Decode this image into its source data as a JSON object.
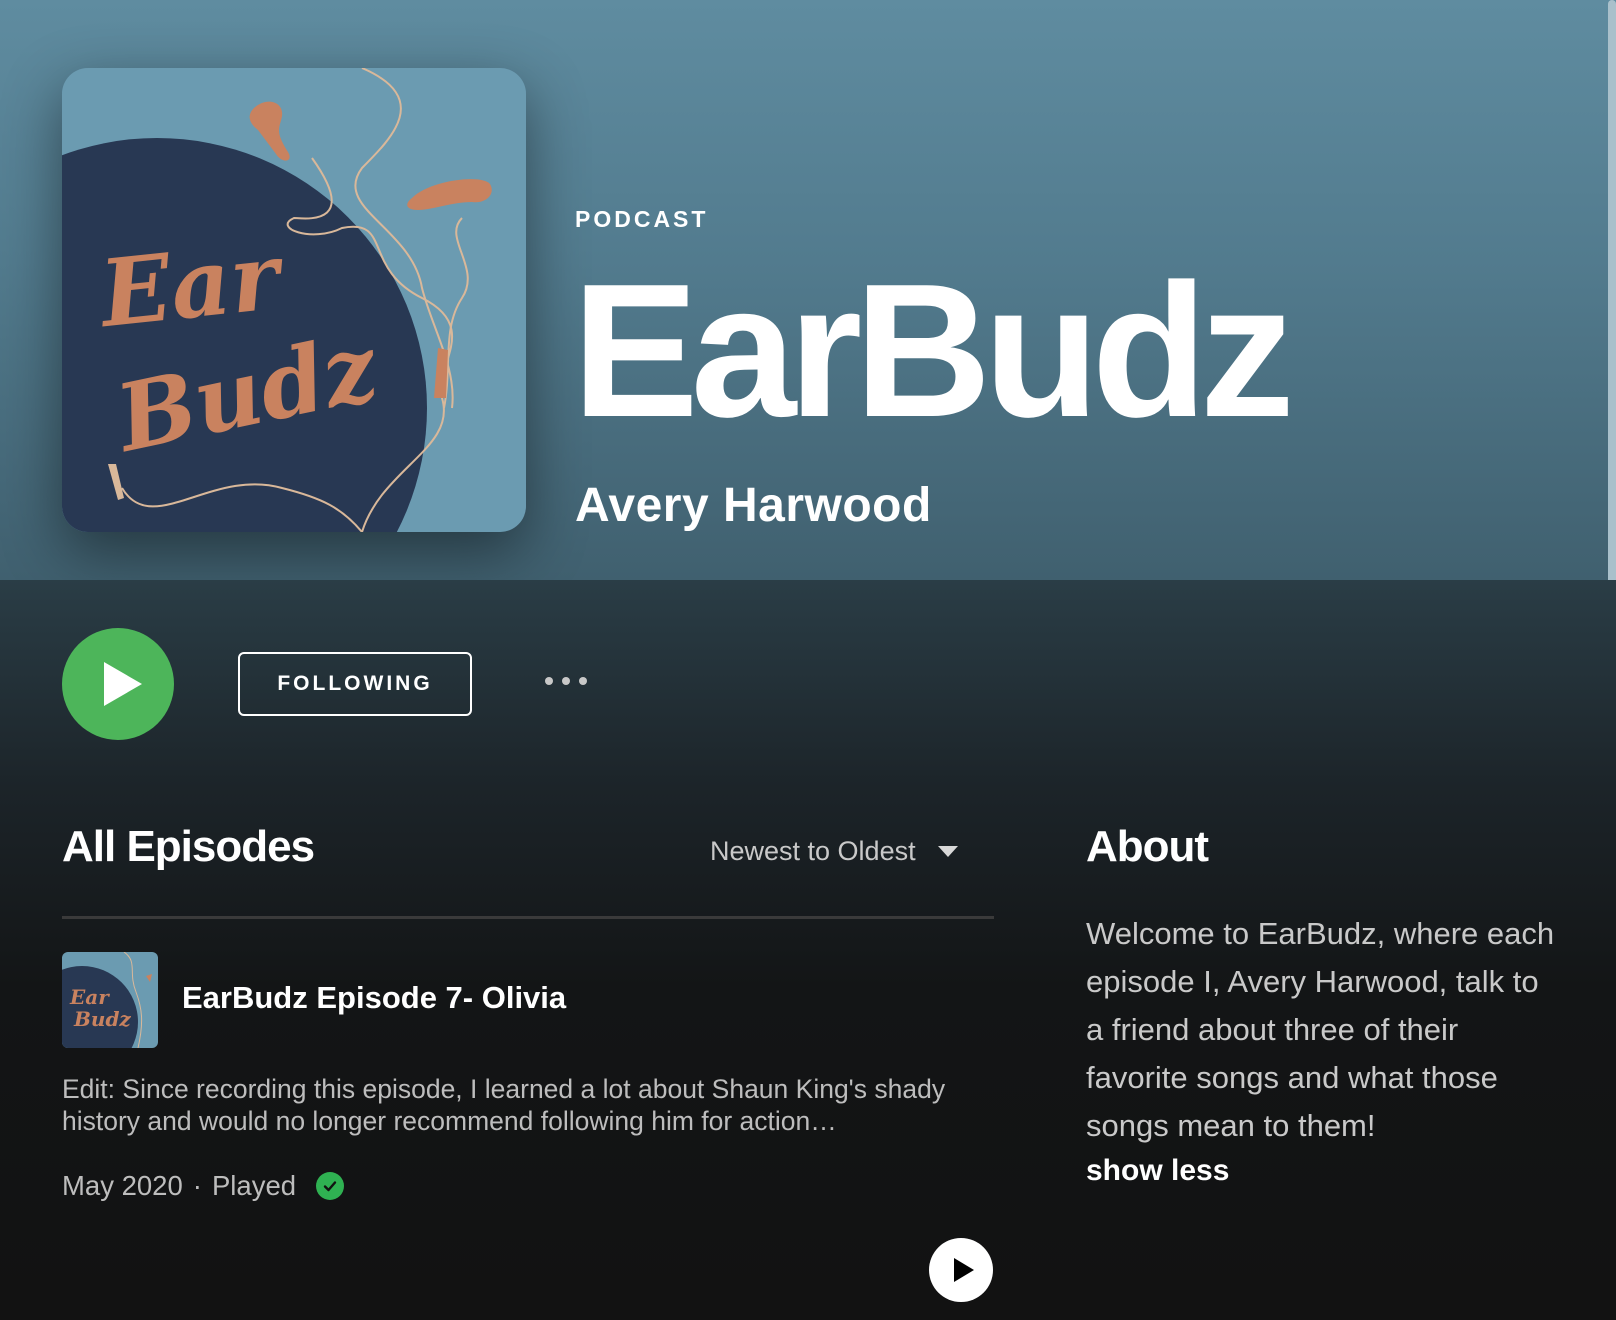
{
  "hero": {
    "type_label": "PODCAST",
    "title": "EarBudz",
    "author": "Avery Harwood",
    "cover_art_text": [
      "Ear",
      "Budz"
    ]
  },
  "actions": {
    "play_icon": "play-icon",
    "follow_label": "FOLLOWING",
    "more_icon": "more-horizontal-icon"
  },
  "episodes": {
    "section_title": "All Episodes",
    "sort_label": "Newest to Oldest",
    "items": [
      {
        "title": "EarBudz Episode 7- Olivia",
        "description": "Edit: Since recording this episode, I learned a lot about Shaun King's shady history and would no longer recommend following him for action…",
        "date": "May 2020",
        "separator": "·",
        "status": "Played"
      }
    ]
  },
  "about": {
    "title": "About",
    "text": "Welcome to EarBudz, where each episode I, Avery Harwood, talk to a friend about three of their favorite songs and what those songs mean to them!",
    "toggle_label": "show less"
  },
  "colors": {
    "hero_top": "#5f8ca0",
    "play_green": "#4db55a",
    "played_check": "#2fb152",
    "background": "#121212"
  }
}
